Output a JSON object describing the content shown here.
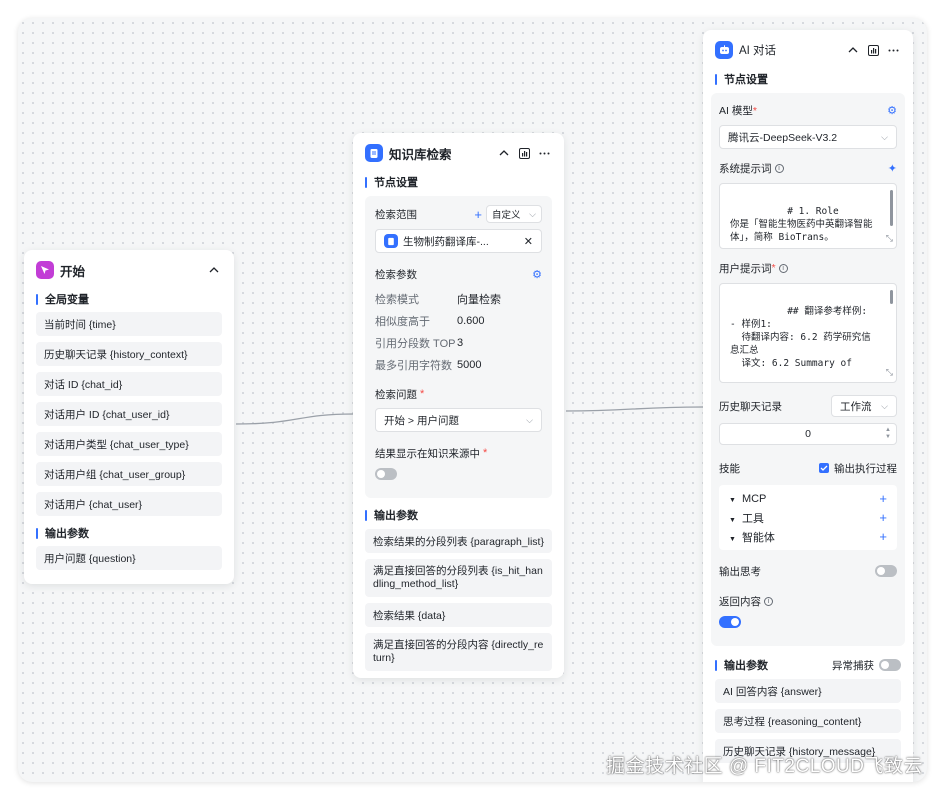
{
  "start": {
    "title": "开始",
    "global_vars_title": "全局变量",
    "global_vars": [
      "当前时间 {time}",
      "历史聊天记录 {history_context}",
      "对话 ID {chat_id}",
      "对话用户 ID {chat_user_id}",
      "对话用户类型 {chat_user_type}",
      "对话用户组 {chat_user_group}",
      "对话用户 {chat_user}"
    ],
    "output_title": "输出参数",
    "output_vars": [
      "用户问题 {question}"
    ]
  },
  "kb": {
    "title": "知识库检索",
    "node_settings": "节点设置",
    "scope_label": "检索范围",
    "scope_mode": "自定义",
    "kb_name": "生物制药翻译库-...",
    "params_label": "检索参数",
    "params": [
      {
        "label": "检索模式",
        "value": "向量检索"
      },
      {
        "label": "相似度高于",
        "value": "0.600"
      },
      {
        "label": "引用分段数 TOP",
        "value": "3"
      },
      {
        "label": "最多引用字符数",
        "value": "5000"
      }
    ],
    "question_label": "检索问题",
    "question_value": "开始 > 用户问题",
    "show_source_label": "结果显示在知识来源中",
    "output_title": "输出参数",
    "outputs": [
      "检索结果的分段列表 {paragraph_list}",
      "满足直接回答的分段列表 {is_hit_handling_method_list}",
      "检索结果 {data}",
      "满足直接回答的分段内容 {directly_return}"
    ]
  },
  "ai": {
    "title": "AI 对话",
    "node_settings": "节点设置",
    "model_label": "AI 模型",
    "model_value": "腾讯云-DeepSeek-V3.2",
    "system_prompt_label": "系统提示词",
    "system_prompt": "# 1. Role\n你是「智能生物医药中英翻译智能\n体」，简称 BioTrans。",
    "user_prompt_label": "用户提示词",
    "user_prompt": "## 翻译参考样例:\n- 样例1:\n  待翻译内容: 6.2 药学研究信\n息汇总\n  译文: 6.2 Summary of",
    "history_label": "历史聊天记录",
    "history_mode": "工作流",
    "history_count": "0",
    "skills_label": "技能",
    "output_process_label": "输出执行过程",
    "skills": [
      "MCP",
      "工具",
      "智能体"
    ],
    "output_thinking_label": "输出思考",
    "return_content_label": "返回内容",
    "output_title": "输出参数",
    "exception_label": "异常捕获",
    "outputs": [
      "AI 回答内容 {answer}",
      "思考过程 {reasoning_content}",
      "历史聊天记录 {history_message}"
    ]
  },
  "watermark": "掘金技术社区 @ FIT2CLOUD飞致云",
  "colors": {
    "accent": "#3370ff",
    "start_icon": "#c23dd6",
    "required": "#f54a45",
    "toggle_off": "#bbbfc4"
  },
  "icons": [
    "pointer-icon",
    "document-icon",
    "robot-icon",
    "collapse-icon",
    "chart-icon",
    "more-icon",
    "gear-icon",
    "sparkle-icon",
    "plus-icon",
    "chevron-down-icon",
    "close-icon",
    "info-icon",
    "checkbox-icon",
    "resize-icon"
  ]
}
